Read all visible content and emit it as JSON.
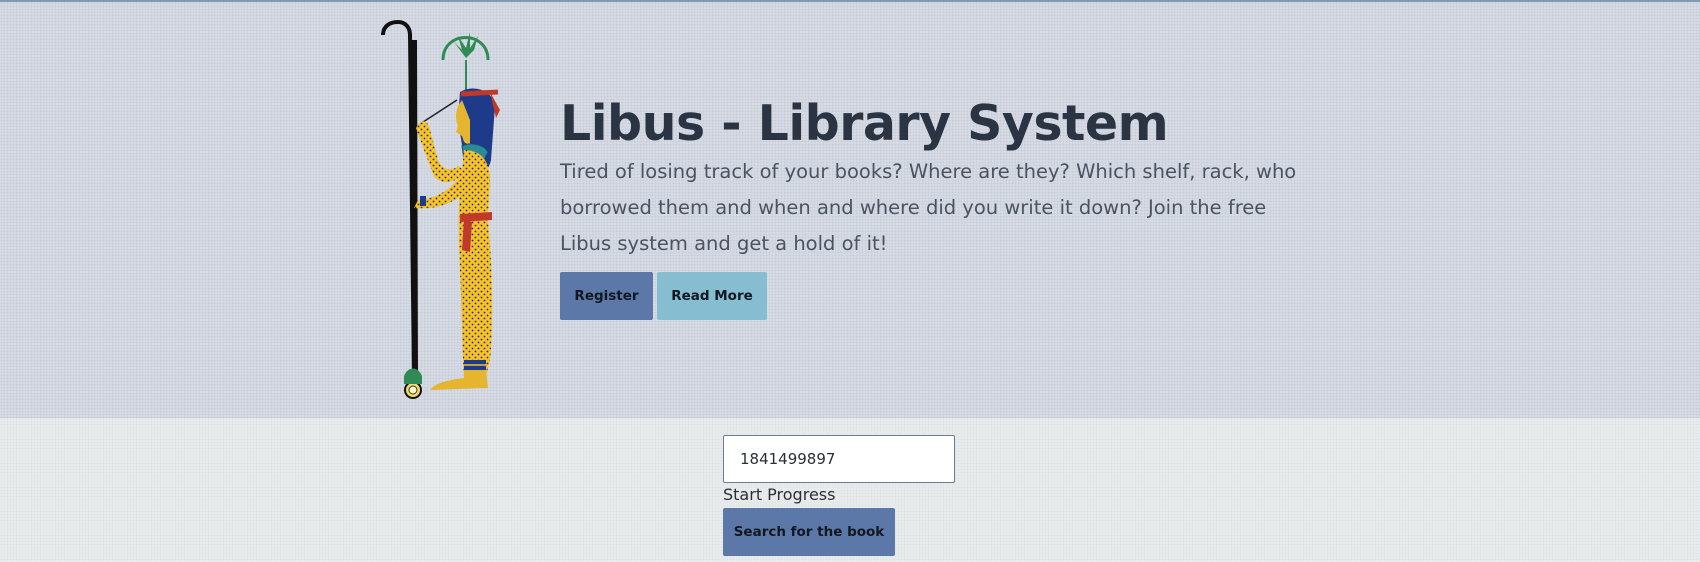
{
  "hero": {
    "title": "Libus - Library System",
    "description": "Tired of losing track of your books? Where are they? Which shelf, rack, who borrowed them and when and where did you write it down? Join the free Libus system and get a hold of it!",
    "illustration_icon": "egyptian-goddess-seshat-illustration",
    "register_label": "Register",
    "read_more_label": "Read More"
  },
  "search": {
    "isbn_value": "1841499897",
    "progress_label": "Start Progress",
    "button_label": "Search for the book"
  },
  "colors": {
    "hero_background": "#d8dde6",
    "page_background": "#ebeeef",
    "primary_button": "#5b78a8",
    "secondary_button": "#86bdd0",
    "title_text": "#2b3442",
    "accent_top_border": "#7f9bb4"
  }
}
